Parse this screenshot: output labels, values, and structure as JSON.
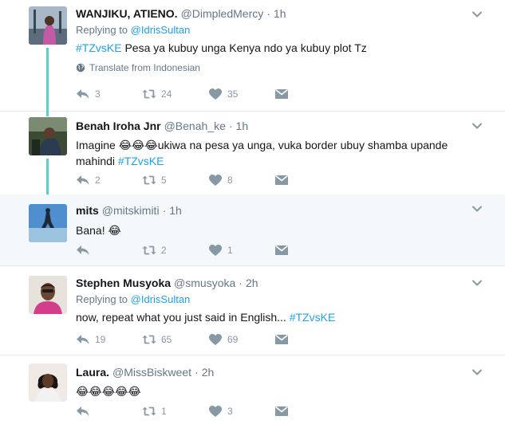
{
  "tweets": [
    {
      "fullname": "WANJIKU, ATIENO.",
      "username": "@DimpledMercy",
      "sep": "·",
      "time": "1h",
      "replying_prefix": "Replying to ",
      "replying_to": "@IdrisSultan",
      "text_hashtag": "#TZvsKE",
      "text": " Pesa ya kubuy unga Kenya ndo ya kubuy plot Tz",
      "translate": "Translate from Indonesian",
      "replies": "3",
      "retweets": "24",
      "likes": "35"
    },
    {
      "fullname": "Benah Iroha Jnr",
      "username": "@Benah_ke",
      "sep": "·",
      "time": "1h",
      "text": "Imagine 😂😂😂ukiwa na pesa ya unga, vuka border ubuy shamba upande mahindi ",
      "text_hashtag": "#TZvsKE",
      "replies": "2",
      "retweets": "5",
      "likes": "8"
    },
    {
      "fullname": "mits",
      "username": "@mitskimiti",
      "sep": "·",
      "time": "1h",
      "text": "Bana! 😂",
      "replies": "",
      "retweets": "2",
      "likes": "1"
    },
    {
      "fullname": "Stephen Musyoka",
      "username": "@smusyoka",
      "sep": "·",
      "time": "2h",
      "replying_prefix": "Replying to ",
      "replying_to": "@IdrisSultan",
      "text": "now, repeat what you just said in English... ",
      "text_hashtag": "#TZvsKE",
      "replies": "19",
      "retweets": "65",
      "likes": "69"
    },
    {
      "fullname": "Laura.",
      "username": "@MissBiskweet",
      "sep": "·",
      "time": "2h",
      "text": "😂😂😂😂😂",
      "replies": "",
      "retweets": "1",
      "likes": "3"
    }
  ],
  "icons": {
    "reply": "reply-icon",
    "retweet": "retweet-icon",
    "like": "heart-icon",
    "dm": "direct-message-icon",
    "more": "chevron-down-icon",
    "globe": "globe-icon"
  },
  "colors": {
    "accent": "#1da1f2",
    "connector": "#59d0c9",
    "muted": "#657786",
    "highlight_bg": "#f5f8fa"
  }
}
